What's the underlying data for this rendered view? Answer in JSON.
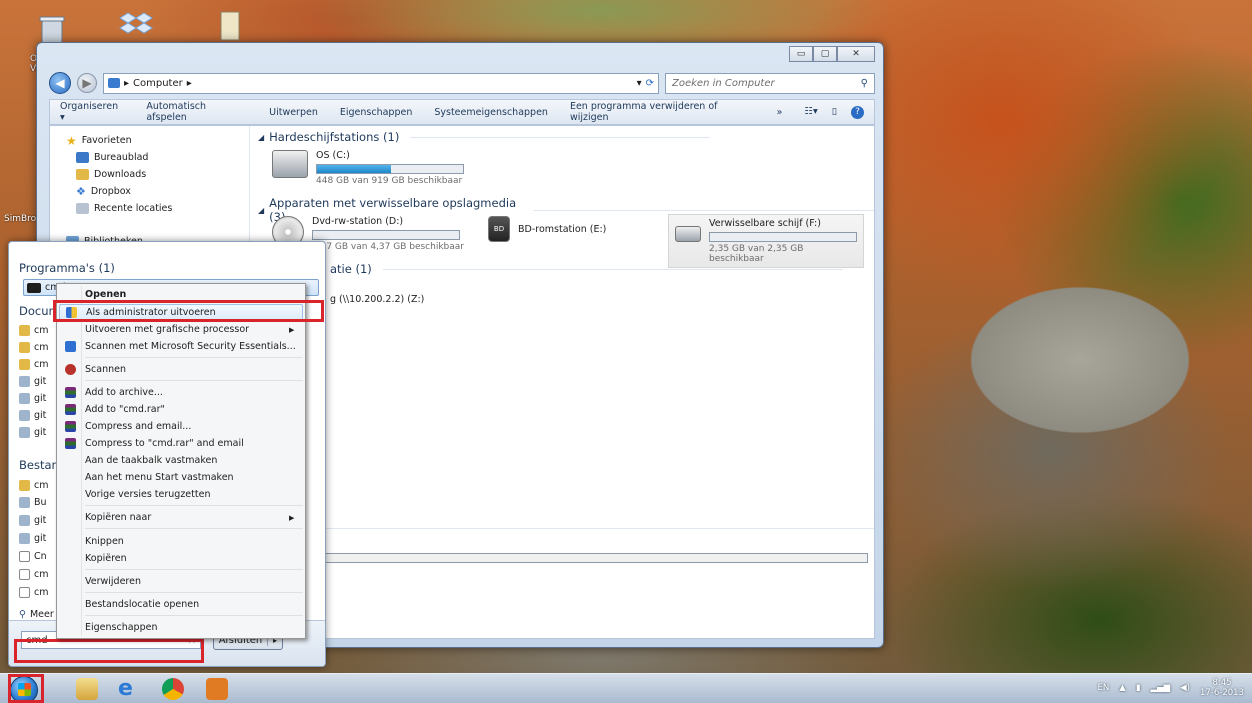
{
  "desktop": {
    "labels": [
      "Ora Vin",
      "SimBrov"
    ]
  },
  "explorer": {
    "address": {
      "path": "Computer",
      "search_placeholder": "Zoeken in Computer"
    },
    "window_controls": {
      "minimize": "▭",
      "maximize": "▢",
      "close": "✕"
    },
    "toolbar": {
      "items": [
        "Organiseren ▾",
        "Automatisch afspelen",
        "Uitwerpen",
        "Eigenschappen",
        "Systeemeigenschappen",
        "Een programma verwijderen of wijzigen",
        "»"
      ]
    },
    "nav": {
      "favorites": "Favorieten",
      "items": [
        "Bureaublad",
        "Downloads",
        "Dropbox",
        "Recente locaties"
      ],
      "libraries": "Bibliotheken"
    },
    "groups": {
      "hdd": "Hardeschijfstations (1)",
      "removable": "Apparaten met verwisselbare opslagmedia (3)",
      "network": "atie (1)"
    },
    "drives": {
      "c": {
        "name": "OS (C:)",
        "info": "448 GB van 919 GB beschikbaar",
        "used": 0.51
      },
      "d": {
        "name": "Dvd-rw-station (D:)",
        "info": "4,37 GB van 4,37 GB beschikbaar",
        "used": 0.0
      },
      "e": {
        "name": "BD-romstation (E:)"
      },
      "f": {
        "name": "Verwisselbare schijf (F:)",
        "info": "2,35 GB van 2,35 GB beschikbaar",
        "used": 0.0
      },
      "net": {
        "name": "g (\\\\10.200.2.2) (Z:)"
      }
    }
  },
  "startmenu": {
    "programs_head": "Programma's (1)",
    "selected_program": "cmd",
    "documents_head": "Docum",
    "doc_items": [
      "cm",
      "cm",
      "cm",
      "git",
      "git",
      "git",
      "git"
    ],
    "files_head": "Bestan",
    "file_items": [
      "cm",
      "Bu",
      "git",
      "git",
      "Cn",
      "cm",
      "cm"
    ],
    "more": "Meer",
    "search_value": "cmd",
    "search_clear": "×",
    "shutdown_label": "Afsluiten",
    "shutdown_arrow": "▸"
  },
  "context_menu": {
    "items": [
      "Openen",
      "Als administrator uitvoeren",
      "Uitvoeren met grafische processor",
      "Scannen met Microsoft Security Essentials...",
      "Scannen",
      "Add to archive...",
      "Add to \"cmd.rar\"",
      "Compress and email...",
      "Compress to \"cmd.rar\" and email",
      "Aan de taakbalk vastmaken",
      "Aan het menu Start vastmaken",
      "Vorige versies terugzetten",
      "Kopiëren naar",
      "Knippen",
      "Kopiëren",
      "Verwijderen",
      "Bestandslocatie openen",
      "Eigenschappen"
    ]
  },
  "taskbar": {
    "lang": "EN",
    "time": "8:45",
    "date": "17-6-2013"
  },
  "colors": {
    "highlight_red": "#d9242c",
    "accent_blue": "#2b7cd3"
  }
}
